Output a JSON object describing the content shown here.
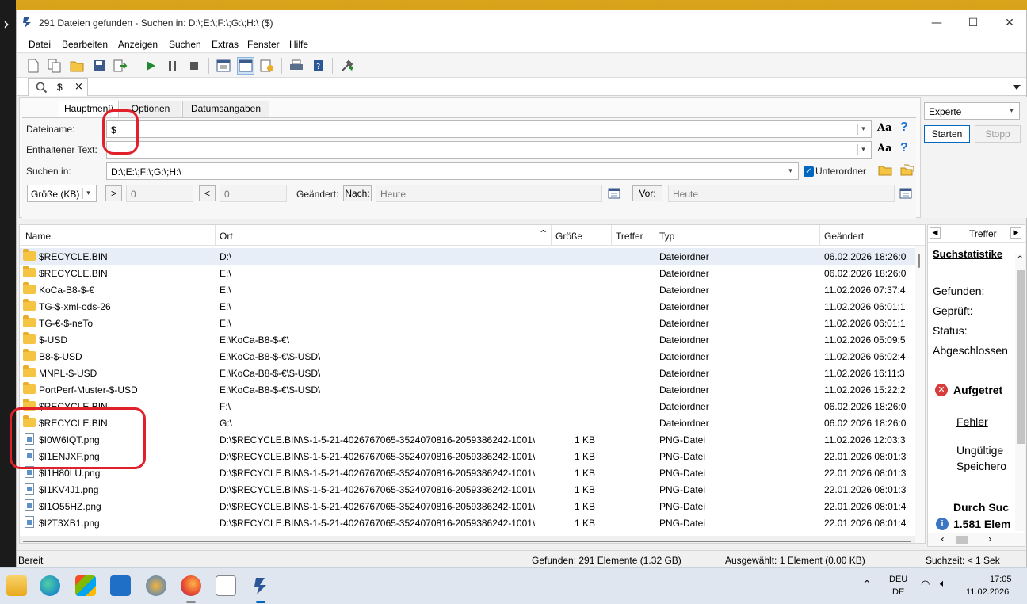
{
  "window": {
    "title": "291 Dateien gefunden - Suchen in: D:\\;E:\\;F:\\;G:\\;H:\\ ($)"
  },
  "menu": [
    "Datei",
    "Bearbeiten",
    "Anzeigen",
    "Suchen",
    "Extras",
    "Fenster",
    "Hilfe"
  ],
  "doc_tab": {
    "label": "$"
  },
  "subtabs": [
    "Hauptmenü",
    "Optionen",
    "Datumsangaben"
  ],
  "form": {
    "dateiname_label": "Dateiname:",
    "dateiname_value": "$",
    "enthaltener_label": "Enthaltener Text:",
    "enthaltener_value": "",
    "suchen_label": "Suchen in:",
    "suchen_value": "D:\\;E:\\;F:\\;G:\\;H:\\",
    "unterordner_label": "Unterordner",
    "groesse_select": "Größe (KB)",
    "gt": ">",
    "gt_value": "0",
    "lt": "<",
    "lt_value": "0",
    "geaendert_label": "Geändert:",
    "nach_label": "Nach:",
    "nach_value": "Heute",
    "vor_label": "Vor:",
    "vor_value": "Heute"
  },
  "right_controls": {
    "mode": "Experte",
    "start": "Starten",
    "stop": "Stopp"
  },
  "columns": [
    "Name",
    "Ort",
    "Größe",
    "Treffer",
    "Typ",
    "Geändert"
  ],
  "rows": [
    {
      "name": "$RECYCLE.BIN",
      "ort": "D:\\",
      "size": "",
      "typ": "Dateiordner",
      "date": "06.02.2026 18:26:0",
      "kind": "folder"
    },
    {
      "name": "$RECYCLE.BIN",
      "ort": "E:\\",
      "size": "",
      "typ": "Dateiordner",
      "date": "06.02.2026 18:26:0",
      "kind": "folder"
    },
    {
      "name": "KoCa-B8-$-€",
      "ort": "E:\\",
      "size": "",
      "typ": "Dateiordner",
      "date": "11.02.2026 07:37:4",
      "kind": "folder"
    },
    {
      "name": "TG-$-xml-ods-26",
      "ort": "E:\\",
      "size": "",
      "typ": "Dateiordner",
      "date": "11.02.2026 06:01:1",
      "kind": "folder"
    },
    {
      "name": "TG-€-$-neTo",
      "ort": "E:\\",
      "size": "",
      "typ": "Dateiordner",
      "date": "11.02.2026 06:01:1",
      "kind": "folder"
    },
    {
      "name": "$-USD",
      "ort": "E:\\KoCa-B8-$-€\\",
      "size": "",
      "typ": "Dateiordner",
      "date": "11.02.2026 05:09:5",
      "kind": "folder"
    },
    {
      "name": "B8-$-USD",
      "ort": "E:\\KoCa-B8-$-€\\$-USD\\",
      "size": "",
      "typ": "Dateiordner",
      "date": "11.02.2026 06:02:4",
      "kind": "folder"
    },
    {
      "name": "MNPL-$-USD",
      "ort": "E:\\KoCa-B8-$-€\\$-USD\\",
      "size": "",
      "typ": "Dateiordner",
      "date": "11.02.2026 16:11:3",
      "kind": "folder"
    },
    {
      "name": "PortPerf-Muster-$-USD",
      "ort": "E:\\KoCa-B8-$-€\\$-USD\\",
      "size": "",
      "typ": "Dateiordner",
      "date": "11.02.2026 15:22:2",
      "kind": "folder"
    },
    {
      "name": "$RECYCLE.BIN",
      "ort": "F:\\",
      "size": "",
      "typ": "Dateiordner",
      "date": "06.02.2026 18:26:0",
      "kind": "folder"
    },
    {
      "name": "$RECYCLE.BIN",
      "ort": "G:\\",
      "size": "",
      "typ": "Dateiordner",
      "date": "06.02.2026 18:26:0",
      "kind": "folder"
    },
    {
      "name": "$I0W6IQT.png",
      "ort": "D:\\$RECYCLE.BIN\\S-1-5-21-4026767065-3524070816-2059386242-1001\\",
      "size": "1 KB",
      "typ": "PNG-Datei",
      "date": "11.02.2026 12:03:3",
      "kind": "file"
    },
    {
      "name": "$I1ENJXF.png",
      "ort": "D:\\$RECYCLE.BIN\\S-1-5-21-4026767065-3524070816-2059386242-1001\\",
      "size": "1 KB",
      "typ": "PNG-Datei",
      "date": "22.01.2026 08:01:3",
      "kind": "file"
    },
    {
      "name": "$I1H80LU.png",
      "ort": "D:\\$RECYCLE.BIN\\S-1-5-21-4026767065-3524070816-2059386242-1001\\",
      "size": "1 KB",
      "typ": "PNG-Datei",
      "date": "22.01.2026 08:01:3",
      "kind": "file"
    },
    {
      "name": "$I1KV4J1.png",
      "ort": "D:\\$RECYCLE.BIN\\S-1-5-21-4026767065-3524070816-2059386242-1001\\",
      "size": "1 KB",
      "typ": "PNG-Datei",
      "date": "22.01.2026 08:01:3",
      "kind": "file"
    },
    {
      "name": "$I1O55HZ.png",
      "ort": "D:\\$RECYCLE.BIN\\S-1-5-21-4026767065-3524070816-2059386242-1001\\",
      "size": "1 KB",
      "typ": "PNG-Datei",
      "date": "22.01.2026 08:01:4",
      "kind": "file"
    },
    {
      "name": "$I2T3XB1.png",
      "ort": "D:\\$RECYCLE.BIN\\S-1-5-21-4026767065-3524070816-2059386242-1001\\",
      "size": "1 KB",
      "typ": "PNG-Datei",
      "date": "22.01.2026 08:01:4",
      "kind": "file"
    }
  ],
  "side": {
    "tab": "Treffer",
    "heading": "Suchstatistike",
    "gefunden": "Gefunden:",
    "geprueft": "Geprüft:",
    "status": "Status:",
    "abgeschlossen": "Abgeschlossen",
    "aufgetreten": "Aufgetret",
    "fehler": "Fehler",
    "ungueltig": "Ungültige",
    "speicher": "Speichero",
    "durch": "Durch Suc",
    "count": "1.581 Elem"
  },
  "status": {
    "left": "Bereit",
    "found": "Gefunden: 291 Elemente (1.32 GB)",
    "selected": "Ausgewählt: 1 Element (0.00 KB)",
    "time": "Suchzeit: < 1 Sek"
  },
  "taskbar": {
    "lang1": "DEU",
    "lang2": "DE",
    "time": "17:05",
    "date": "11.02.2026"
  },
  "colors": {
    "highlight": "#e0202b",
    "accent": "#0067c0",
    "folder": "#f5c443"
  }
}
